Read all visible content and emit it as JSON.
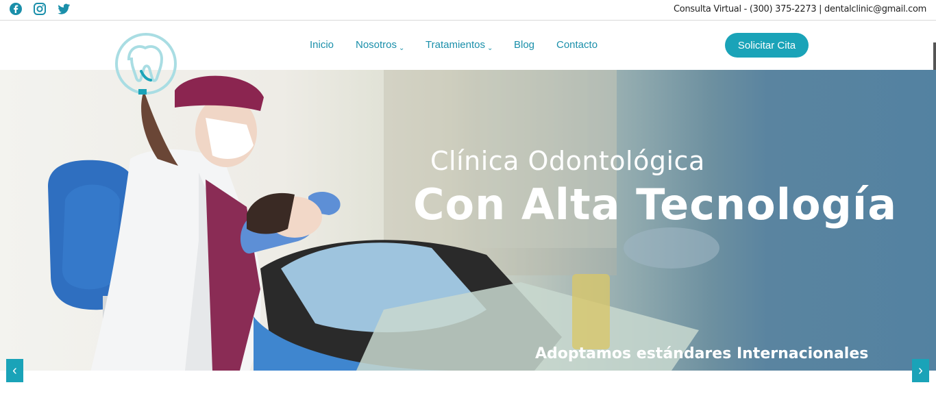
{
  "topbar": {
    "social_icons": [
      "facebook-icon",
      "instagram-icon",
      "twitter-icon"
    ],
    "contact_text": "Consulta Virtual - (300) 375-2273 | dentalclinic@gmail.com"
  },
  "header": {
    "logo_icon": "tooth-logo-icon",
    "nav": [
      {
        "label": "Inicio",
        "caret": ""
      },
      {
        "label": "Nosotros",
        "caret": "⌄"
      },
      {
        "label": "Tratamientos",
        "caret": "⌄"
      },
      {
        "label": "Blog",
        "caret": ""
      },
      {
        "label": "Contacto",
        "caret": ""
      }
    ],
    "cta_label": "Solicitar Cita"
  },
  "hero": {
    "title_line1": "Clínica Odontológica",
    "title_line2": "Con Alta Tecnología",
    "subtitle": "Adoptamos estándares Internacionales",
    "prev_label": "‹",
    "next_label": "›"
  },
  "colors": {
    "accent": "#1aa3b8",
    "nav_text": "#1a8faa",
    "hero_blue": "#5382a1",
    "social": "#1a8faa"
  }
}
